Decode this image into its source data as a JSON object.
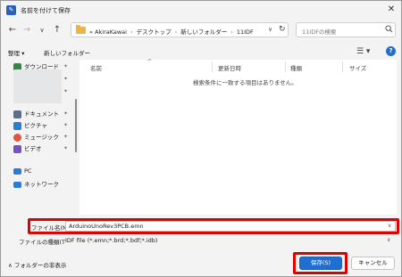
{
  "window": {
    "title": "名前を付けて保存",
    "app_icon_glyph": "✎"
  },
  "nav": {
    "back_glyph": "←",
    "forward_glyph": "→",
    "recent_glyph": "∨",
    "up_glyph": "↑"
  },
  "address": {
    "prefix": "«",
    "crumbs": [
      "AkiraKawai",
      "デスクトップ",
      "新しいフォルダー",
      "11IDF"
    ],
    "separator": "›",
    "dropdown_glyph": "∨",
    "refresh_glyph": "↻"
  },
  "search": {
    "placeholder": "11IDFの検索"
  },
  "toolbar": {
    "organize": "整理 ▾",
    "new_folder": "新しいフォルダー",
    "view_glyph": "☰ ▾",
    "help_glyph": "?"
  },
  "sidebar": {
    "items": [
      {
        "label": "ダウンロード",
        "icon": "download-icon",
        "color": "#2d8a3e"
      },
      {
        "label": "ドキュメント",
        "icon": "document-icon",
        "color": "#5a6e8c"
      },
      {
        "label": "ピクチャ",
        "icon": "picture-icon",
        "color": "#2b7cd3"
      },
      {
        "label": "ミュージック",
        "icon": "music-icon",
        "color": "#e0533d"
      },
      {
        "label": "ビデオ",
        "icon": "video-icon",
        "color": "#7a4fbf"
      },
      {
        "label": "PC",
        "icon": "pc-icon",
        "color": "#2b7cd3"
      },
      {
        "label": "ネットワーク",
        "icon": "network-icon",
        "color": "#2b7cd3"
      }
    ],
    "pin_glyph": "✦"
  },
  "filelist": {
    "columns": [
      "名前",
      "更新日時",
      "種類",
      "サイズ"
    ],
    "sort_glyph": "^",
    "empty_message": "検索条件に一致する項目はありません。"
  },
  "form": {
    "filename_label": "ファイル名(N):",
    "filename_value": "ArduinoUnoRev3PCB.emn",
    "filetype_label": "ファイルの種類(T):",
    "filetype_value": "IDF file (*.emn;*.brd;*.bdf;*.idb)",
    "dropdown_glyph": "∨"
  },
  "footer": {
    "hide_folders": "∧  フォルダーの非表示",
    "save_button": "保存(S)",
    "cancel_button": "キャンセル"
  },
  "colors": {
    "highlight": "#e00000",
    "accent": "#1f6fd0",
    "folder": "#e8b64a"
  }
}
